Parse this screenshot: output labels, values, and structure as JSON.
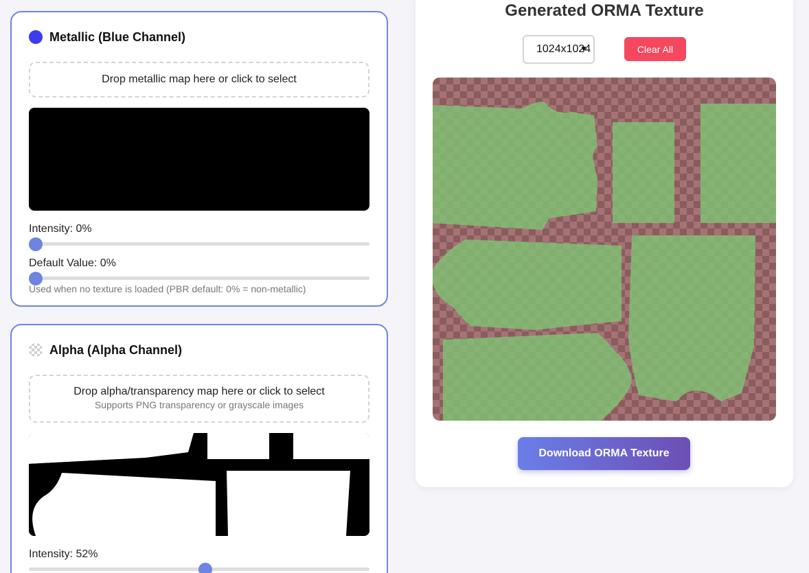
{
  "metallic": {
    "title": "Metallic (Blue Channel)",
    "dot_color": "#3b3bf0",
    "drop_text": "Drop metallic map here or click to select",
    "intensity_label": "Intensity: 0%",
    "intensity_value": 0,
    "default_label": "Default Value: 0%",
    "default_value": 0,
    "hint": "Used when no texture is loaded (PBR default: 0% = non-metallic)"
  },
  "alpha": {
    "title": "Alpha (Alpha Channel)",
    "drop_text": "Drop alpha/transparency map here or click to select",
    "drop_sub": "Supports PNG transparency or grayscale images",
    "intensity_label": "Intensity: 52%",
    "intensity_value": 52
  },
  "output": {
    "title": "Generated ORMA Texture",
    "resolution": "1024x1024",
    "clear_label": "Clear All",
    "download_label": "Download ORMA Texture"
  },
  "colors": {
    "accent": "#6f84e0",
    "danger": "#f5475e",
    "texture_green": "#7fc774"
  }
}
